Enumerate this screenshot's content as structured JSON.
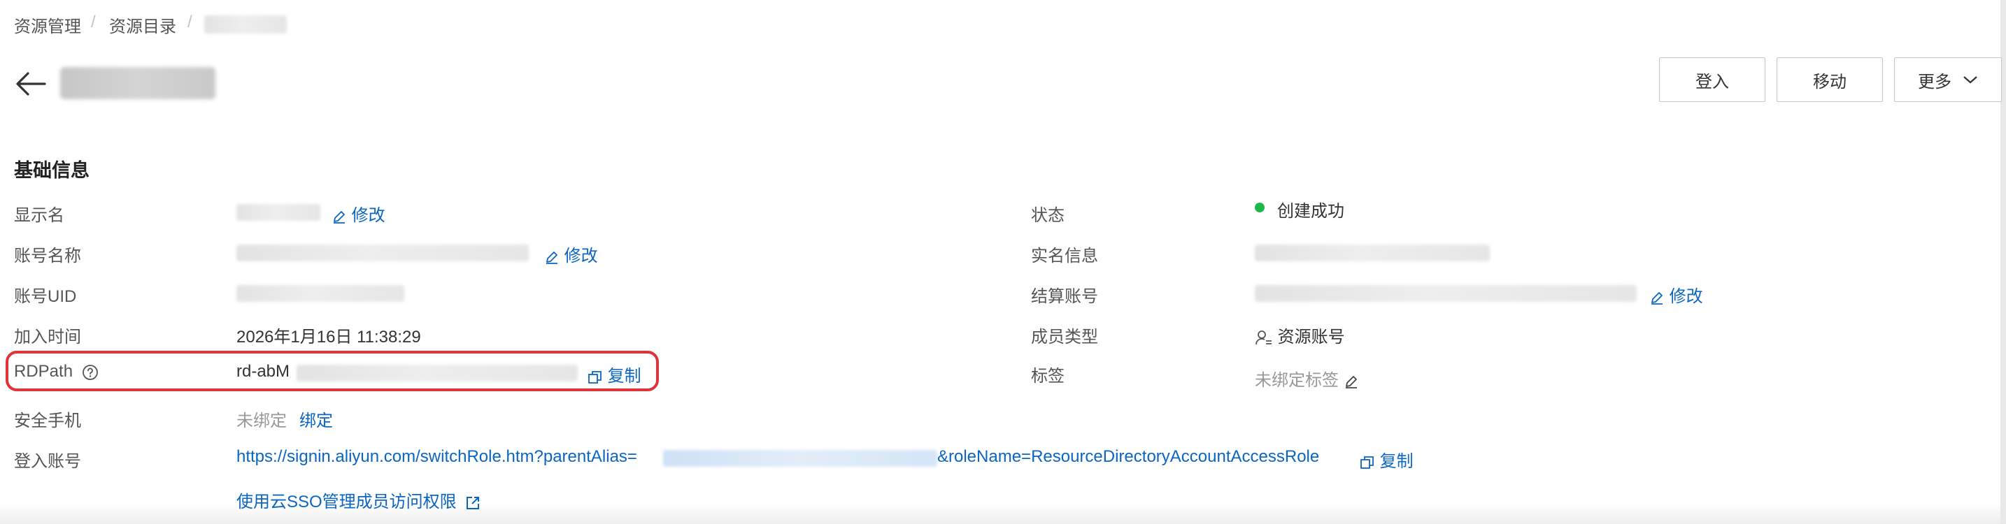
{
  "breadcrumb": {
    "root": "资源管理",
    "section": "资源目录",
    "separator": "/"
  },
  "header": {
    "buttons": {
      "login": "登入",
      "move": "移动",
      "more": "更多"
    }
  },
  "basic_info": {
    "title": "基础信息",
    "left": {
      "display_name": {
        "label": "显示名",
        "action": "修改"
      },
      "account_name": {
        "label": "账号名称",
        "action": "修改"
      },
      "account_uid": {
        "label": "账号UID"
      },
      "join_time": {
        "label": "加入时间",
        "value": "2026年1月16日 11:38:29"
      },
      "rdpath": {
        "label": "RDPath",
        "value_prefix": "rd-abM",
        "action": "复制"
      },
      "security_phone": {
        "label": "安全手机",
        "value": "未绑定",
        "action": "绑定"
      },
      "login_account": {
        "label": "登入账号",
        "url_prefix": "https://signin.aliyun.com/switchRole.htm?parentAlias=",
        "url_suffix": "&roleName=ResourceDirectoryAccountAccessRole",
        "action": "复制"
      },
      "sso_link": "使用云SSO管理成员访问权限"
    },
    "right": {
      "status": {
        "label": "状态",
        "value": "创建成功",
        "color": "#1fb94b"
      },
      "realname": {
        "label": "实名信息"
      },
      "billing": {
        "label": "结算账号",
        "action": "修改"
      },
      "member_type": {
        "label": "成员类型",
        "value": "资源账号"
      },
      "tags": {
        "label": "标签",
        "value": "未绑定标签"
      }
    }
  },
  "colors": {
    "link": "#0b66c3",
    "highlight": "#e0343b"
  },
  "icons": [
    "arrow-left-icon",
    "edit-icon",
    "help-icon",
    "copy-icon",
    "user-icon",
    "external-link-icon",
    "chevron-down-icon"
  ]
}
